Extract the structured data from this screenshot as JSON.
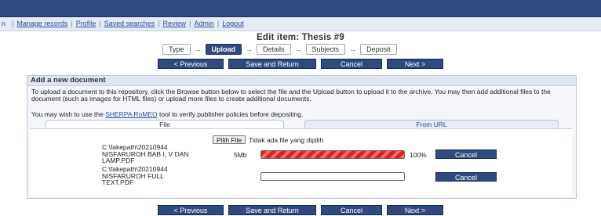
{
  "menu": {
    "lead": "n",
    "items": [
      "Manage records",
      "Profile",
      "Saved searches",
      "Review",
      "Admin",
      "Logout"
    ]
  },
  "title": "Edit item: Thesis #9",
  "workflow": {
    "steps": [
      "Type",
      "Upload",
      "Details",
      "Subjects",
      "Deposit"
    ],
    "active_index": 1,
    "arrow": "→"
  },
  "buttons": {
    "previous": "< Previous",
    "save": "Save and Return",
    "cancel": "Cancel",
    "next": "Next >"
  },
  "panel": {
    "heading": "Add a new document",
    "intro": "To upload a document to this repository, click the Browse button below to select the file and the Upload button to upload it to the archive. You may then add additional files to the document (such as images for HTML files) or upload more files to create additional documents.",
    "sherpa_pre": "You may wish to use the ",
    "sherpa_link": "SHERPA RoMEO",
    "sherpa_post": " tool to verify publisher policies before depositing.",
    "tabs": {
      "file": "File",
      "url": "From URL"
    },
    "file_button": "Pilih File",
    "file_status": "Tidak ada file yang dipilih",
    "uploads": [
      {
        "name_lines": [
          "C:\\fakepath\\20210944",
          "NISFARUROH BAB I, V DAN",
          "LAMP.PDF"
        ],
        "size": "5Mb",
        "progress": 100,
        "percent_label": "100%",
        "cancel": "Cancel"
      },
      {
        "name_lines": [
          "C:\\fakepath\\20210944",
          "NISFARUROH FULL",
          "TEXT.PDF"
        ],
        "size": "",
        "progress": 0,
        "percent_label": "",
        "cancel": "Cancel"
      }
    ]
  },
  "colors": {
    "navy": "#2f4a7e",
    "progress_red": "#e02020",
    "link": "#2b4d9a"
  }
}
